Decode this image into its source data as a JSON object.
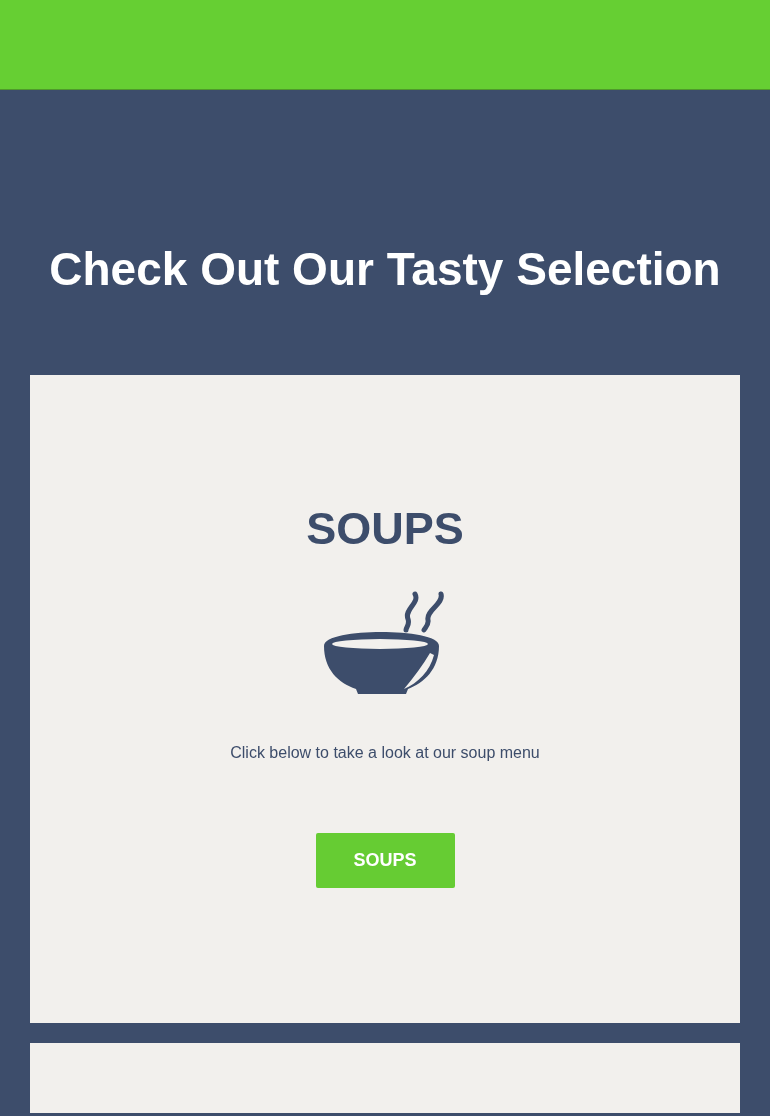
{
  "heading": "Check Out Our Tasty Selection",
  "cards": [
    {
      "title": "SOUPS",
      "text": "Click below to take a look at our soup menu",
      "button": "SOUPS"
    }
  ]
}
